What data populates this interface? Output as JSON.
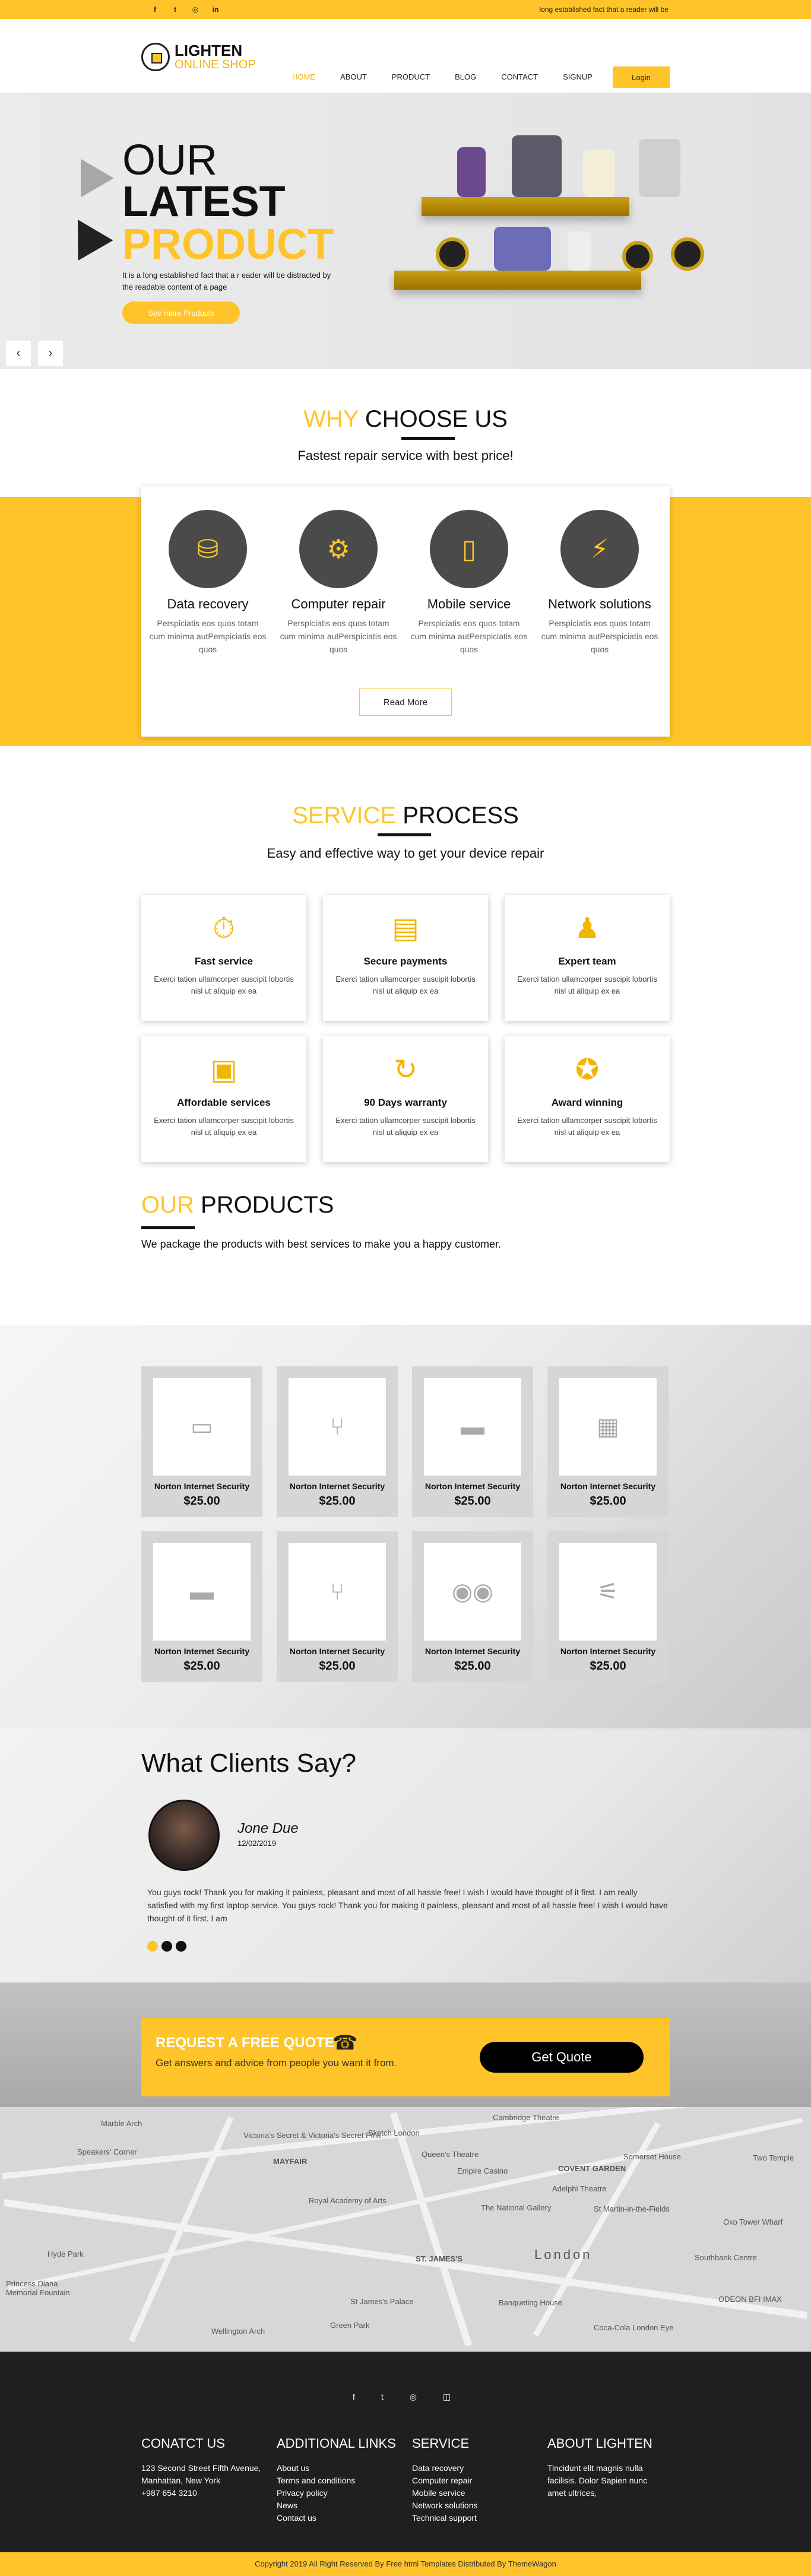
{
  "topbar": {
    "social": [
      "f",
      "t",
      "◎",
      "in"
    ],
    "message": "long established fact that a reader will be"
  },
  "logo": {
    "line1": "LIGHTEN",
    "line2": "ONLINE SHOP"
  },
  "nav": [
    "HOME",
    "ABOUT",
    "PRODUCT",
    "BLOG",
    "CONTACT",
    "SIGNUP"
  ],
  "login_label": "Login",
  "hero": {
    "line1": "OUR",
    "line2": "LATEST",
    "line3": "PRODUCT",
    "text": "It is a long established fact that a r eader will be distracted by the readable content of a page",
    "cta": "See more Products",
    "prev": "‹",
    "next": "›"
  },
  "why": {
    "title_a": "WHY",
    "title_b": "CHOOSE US",
    "subtitle": "Fastest repair service with best price!",
    "items": [
      {
        "title": "Data recovery",
        "text": "Perspiciatis eos quos totam cum minima autPerspiciatis eos quos"
      },
      {
        "title": "Computer repair",
        "text": "Perspiciatis eos quos totam cum minima autPerspiciatis eos quos"
      },
      {
        "title": "Mobile service",
        "text": "Perspiciatis eos quos totam cum minima autPerspiciatis eos quos"
      },
      {
        "title": "Network solutions",
        "text": "Perspiciatis eos quos totam cum minima autPerspiciatis eos quos"
      }
    ],
    "read_more": "Read More"
  },
  "process": {
    "title_a": "SERVICE",
    "title_b": "PROCESS",
    "subtitle": "Easy and effective way to get your device repair",
    "items": [
      {
        "title": "Fast service",
        "text": "Exerci tation ullamcorper suscipit lobortis nisl ut aliquip ex ea"
      },
      {
        "title": "Secure payments",
        "text": "Exerci tation ullamcorper suscipit lobortis nisl ut aliquip ex ea"
      },
      {
        "title": "Expert team",
        "text": "Exerci tation ullamcorper suscipit lobortis nisl ut aliquip ex ea"
      },
      {
        "title": "Affordable services",
        "text": "Exerci tation ullamcorper suscipit lobortis nisl ut aliquip ex ea"
      },
      {
        "title": "90 Days warranty",
        "text": "Exerci tation ullamcorper suscipit lobortis nisl ut aliquip ex ea"
      },
      {
        "title": "Award winning",
        "text": "Exerci tation ullamcorper suscipit lobortis nisl ut aliquip ex ea"
      }
    ]
  },
  "products": {
    "title_a": "OUR",
    "title_b": "PRODUCTS",
    "subtitle": "We package the products with best services to make you a happy customer.",
    "items": [
      {
        "name": "Norton Internet Security",
        "price": "$25.00"
      },
      {
        "name": "Norton Internet Security",
        "price": "$25.00"
      },
      {
        "name": "Norton Internet Security",
        "price": "$25.00"
      },
      {
        "name": "Norton Internet Security",
        "price": "$25.00"
      },
      {
        "name": "Norton Internet Security",
        "price": "$25.00"
      },
      {
        "name": "Norton Internet Security",
        "price": "$25.00"
      },
      {
        "name": "Norton Internet Security",
        "price": "$25.00"
      },
      {
        "name": "Norton Internet Security",
        "price": "$25.00"
      }
    ]
  },
  "clients": {
    "title": "What Clients Say?",
    "name": "Jone Due",
    "date": "12/02/2019",
    "quote": "You guys rock! Thank you for making it painless, pleasant and most of all hassle free! I wish I would have thought of it first. I am really satisfied with my first laptop service. You guys rock! Thank you for making it painless, pleasant and most of all hassle free! I wish I would have thought of it first. I am"
  },
  "quote": {
    "title": "REQUEST A FREE QUOTE",
    "text": "Get answers and advice from people you want it from.",
    "button": "Get Quote"
  },
  "map": {
    "labels": [
      "Marble Arch",
      "Victoria's Secret & Victoria's Secret Pink",
      "Sketch London",
      "Cambridge Theatre",
      "Speakers' Corner",
      "MAYFAIR",
      "Queen's Theatre",
      "Somerset House",
      "Two Temple",
      "Empire Casino",
      "COVENT GARDEN",
      "Royal Academy of Arts",
      "Adelphi Theatre",
      "The National Gallery",
      "St Martin-in-the-Fields",
      "Oxo Tower Wharf",
      "Hyde Park",
      "ST. JAMES'S",
      "London",
      "Southbank Centre",
      "Princess Diana Memorial Fountain",
      "St James's Palace",
      "Banqueting House",
      "ODEON BFI IMAX",
      "Wellington Arch",
      "Green Park",
      "Coca-Cola London Eye"
    ]
  },
  "footer": {
    "social": [
      "f",
      "t",
      "◎",
      "◫"
    ],
    "contact": {
      "title": "CONATCT US",
      "lines": [
        "123 Second Street Fifth Avenue,",
        "Manhattan, New York",
        "+987 654 3210"
      ]
    },
    "links": {
      "title": "ADDITIONAL LINKS",
      "lines": [
        "About us",
        "Terms and conditions",
        "Privacy policy",
        "News",
        "Contact us"
      ]
    },
    "service": {
      "title": "SERVICE",
      "lines": [
        "Data recovery",
        "Computer repair",
        "Mobile service",
        "Network solutions",
        "Technical support"
      ]
    },
    "about": {
      "title": "ABOUT LIGHTEN",
      "lines": [
        "Tincidunt elit magnis nulla facilisis. Dolor Sapien nunc amet ultrices,"
      ]
    }
  },
  "copyright": "Copyright 2019 All Right Reserved By Free html Templates Distributed By ThemeWagon",
  "colors": {
    "accent": "#fec429",
    "dark": "#1f1f1f"
  }
}
